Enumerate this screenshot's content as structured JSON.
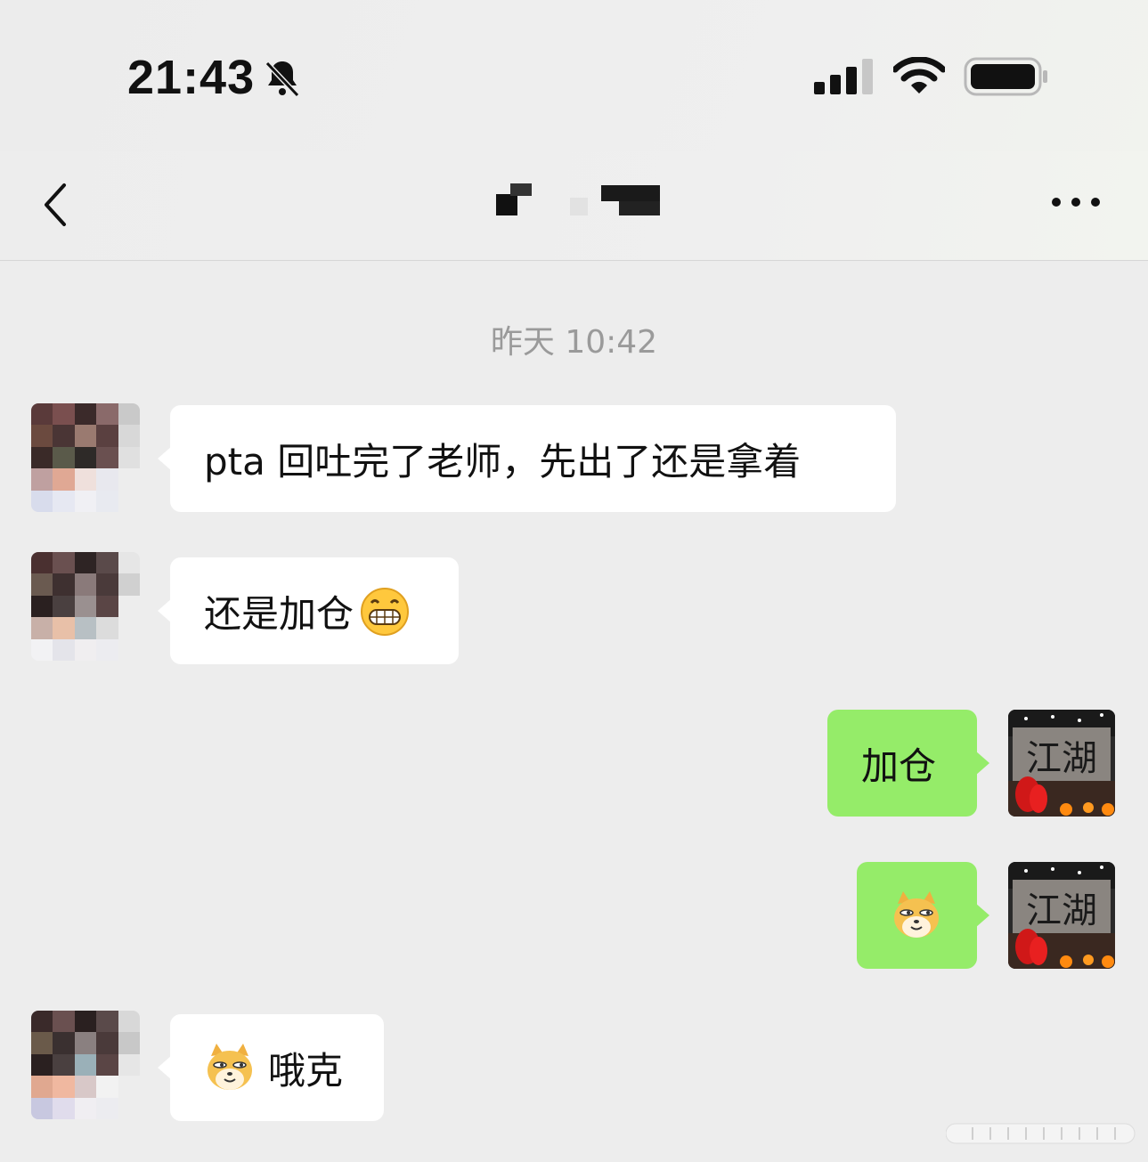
{
  "status_bar": {
    "time": "21:43",
    "icons": [
      "bell-muted-icon",
      "signal-icon",
      "wifi-icon",
      "battery-icon"
    ]
  },
  "nav": {
    "back_icon": "chevron-left-icon",
    "title": "",
    "more_icon": "ellipsis-icon"
  },
  "chat": {
    "timestamp": "昨天 10:42",
    "messages": [
      {
        "side": "left",
        "text": "pta 回吐完了老师，先出了还是拿着",
        "emoji": ""
      },
      {
        "side": "left",
        "text": "还是加仓",
        "emoji": "grin-emoji"
      },
      {
        "side": "right",
        "text": "加仓",
        "emoji": ""
      },
      {
        "side": "right",
        "text": "",
        "emoji": "doge-emoji"
      },
      {
        "side": "left",
        "text": "哦克",
        "emoji": "doge-emoji"
      }
    ]
  },
  "self_avatar": {
    "text": "江湖"
  },
  "colors": {
    "background": "#ededed",
    "incoming_bubble": "#ffffff",
    "outgoing_bubble": "#95ec69",
    "timestamp": "#9a9a9a"
  }
}
